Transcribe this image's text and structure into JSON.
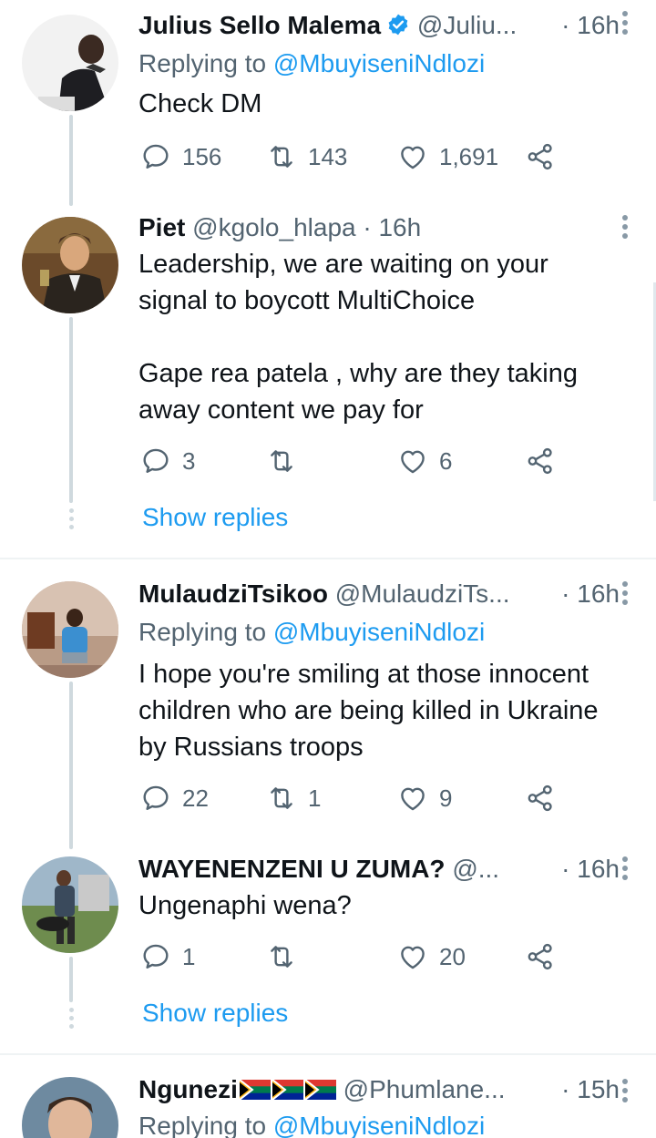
{
  "tweets": [
    {
      "name": "Julius Sello Malema",
      "handle": "@Juliu...",
      "time": "· 16h",
      "replying_prefix": "Replying to ",
      "replying_handle": "@MbuyiseniNdlozi",
      "text": "Check DM",
      "replies": "156",
      "retweets": "143",
      "likes": "1,691"
    },
    {
      "name": "Piet",
      "handle": "@kgolo_hlapa",
      "time": "· 16h",
      "text": "Leadership, we are waiting on your\nsignal to boycott MultiChoice\n\nGape rea patela , why are they taking\naway content we pay for",
      "replies": "3",
      "retweets": "",
      "likes": "6",
      "show_replies": "Show replies"
    },
    {
      "name": "MulaudziTsikoo",
      "handle": "@MulaudziTs...",
      "time": "· 16h",
      "replying_prefix": "Replying to ",
      "replying_handle": "@MbuyiseniNdlozi",
      "text": "I hope you're smiling at those innocent\nchildren who are being killed in Ukraine\nby Russians troops",
      "replies": "22",
      "retweets": "1",
      "likes": "9"
    },
    {
      "name": "WAYENENZENI U ZUMA?",
      "handle": "@...",
      "time": "· 16h",
      "text": "Ungenaphi wena?",
      "replies": "1",
      "retweets": "",
      "likes": "20",
      "show_replies": "Show replies"
    },
    {
      "name": "Ngunezi",
      "handle": "@Phumlane...",
      "time": "· 15h",
      "replying_prefix": "Replying to ",
      "replying_handle": "@MbuyiseniNdlozi"
    }
  ],
  "icons": {
    "reply": "reply-icon",
    "retweet": "retweet-icon",
    "like": "heart-icon",
    "share": "share-icon",
    "verified": "verified-badge-icon",
    "flag": "south-africa-flag-icon"
  },
  "colors": {
    "link": "#1d9bf0",
    "secondary_text": "#536471",
    "verified": "#1d9bf0",
    "thread_line": "#cfd9de"
  }
}
